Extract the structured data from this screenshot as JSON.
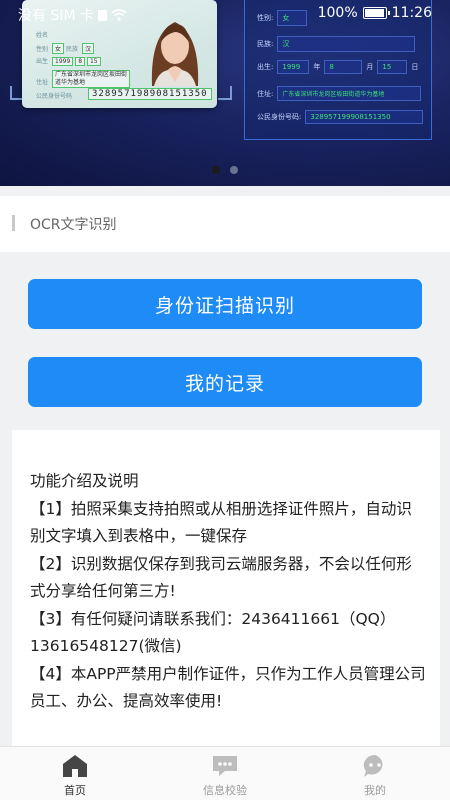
{
  "status_bar": {
    "carrier": "没有 SIM 卡",
    "battery": "100%",
    "time": "11:26"
  },
  "banner": {
    "id_card": {
      "name_label": "姓名",
      "sex_label": "性别",
      "sex_value": "女",
      "nation_label": "民族",
      "nation_value": "汉",
      "birth_label": "出生",
      "birth_year": "1999",
      "birth_month": "8",
      "birth_day": "15",
      "address_label": "住址",
      "address_value": "广东省深圳市龙岗区坂田街道华为基地",
      "id_label": "公民身份号码",
      "id_number": "328957198908151350"
    },
    "form": {
      "sex_label": "性别:",
      "sex_value": "女",
      "nation_label": "民族:",
      "nation_value": "汉",
      "birth_label": "出生:",
      "birth_year": "1999",
      "year_unit": "年",
      "birth_month": "8",
      "month_unit": "月",
      "birth_day": "15",
      "day_unit": "日",
      "address_label": "住址:",
      "address_value": "广东省深圳市龙岗区坂田街道华为基地",
      "id_label": "公民身份号码:",
      "id_value": "328957199908151350"
    }
  },
  "section": {
    "title": "OCR文字识别"
  },
  "buttons": {
    "scan": "身份证扫描识别",
    "records": "我的记录"
  },
  "intro": {
    "heading": "功能介绍及说明",
    "item1": "【1】拍照采集支持拍照或从相册选择证件照片，自动识别文字填入到表格中，一键保存",
    "item2": "【2】识别数据仅保存到我司云端服务器，不会以任何形式分享给任何第三方!",
    "item3": "【3】有任何疑问请联系我们：2436411661（QQ）13616548127(微信)",
    "item4": "【4】本APP严禁用户制作证件，只作为工作人员管理公司员工、办公、提高效率使用!"
  },
  "tabbar": {
    "home": "首页",
    "verify": "信息校验",
    "mine": "我的"
  },
  "colors": {
    "primary_button": "#1e8bf7",
    "banner_bg": "#1a2461",
    "ocr_highlight": "#4fc46b"
  }
}
